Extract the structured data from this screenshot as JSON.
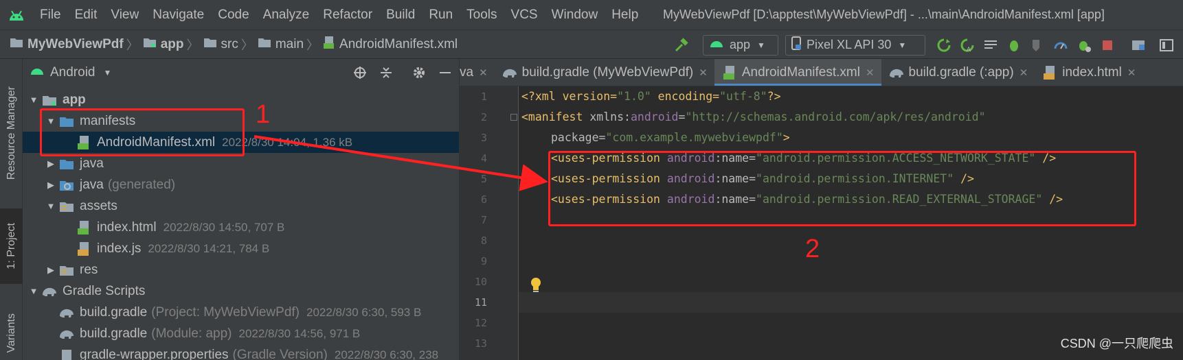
{
  "menu": [
    "File",
    "Edit",
    "View",
    "Navigate",
    "Code",
    "Analyze",
    "Refactor",
    "Build",
    "Run",
    "Tools",
    "VCS",
    "Window",
    "Help"
  ],
  "window_title": "MyWebViewPdf [D:\\apptest\\MyWebViewPdf] - ...\\main\\AndroidManifest.xml [app]",
  "breadcrumb": [
    "MyWebViewPdf",
    "app",
    "src",
    "main",
    "AndroidManifest.xml"
  ],
  "toolbar": {
    "run_config": "app",
    "device": "Pixel XL API 30"
  },
  "side_tabs": {
    "resource_manager": "Resource Manager",
    "project": "1: Project",
    "variants": "Variants"
  },
  "project_panel": {
    "view_mode": "Android",
    "tree": [
      {
        "name": "app",
        "meta": ""
      },
      {
        "name": "manifests",
        "meta": ""
      },
      {
        "name": "AndroidManifest.xml",
        "meta": "2022/8/30 14:04, 1.36 kB"
      },
      {
        "name": "java",
        "meta": ""
      },
      {
        "name": "java",
        "suffix": "(generated)",
        "meta": ""
      },
      {
        "name": "assets",
        "meta": ""
      },
      {
        "name": "index.html",
        "meta": "2022/8/30 14:50, 707 B"
      },
      {
        "name": "index.js",
        "meta": "2022/8/30 14:21, 784 B"
      },
      {
        "name": "res",
        "meta": ""
      },
      {
        "name": "Gradle Scripts",
        "meta": ""
      },
      {
        "name": "build.gradle",
        "suffix": "(Project: MyWebViewPdf)",
        "meta": "2022/8/30 6:30, 593 B"
      },
      {
        "name": "build.gradle",
        "suffix": "(Module: app)",
        "meta": "2022/8/30 14:56, 971 B"
      },
      {
        "name": "gradle-wrapper.properties",
        "suffix": "(Gradle Version)",
        "meta": "2022/8/30 6:30, 238"
      }
    ]
  },
  "editor_tabs": [
    {
      "label": "va"
    },
    {
      "label": "build.gradle (MyWebViewPdf)"
    },
    {
      "label": "AndroidManifest.xml",
      "active": true
    },
    {
      "label": "build.gradle (:app)"
    },
    {
      "label": "index.html"
    }
  ],
  "editor": {
    "line_numbers": [
      "1",
      "2",
      "3",
      "4",
      "5",
      "6",
      "7",
      "8",
      "9",
      "10",
      "11",
      "12",
      "13"
    ],
    "current_line": "11",
    "lines": {
      "l1": {
        "a": "<?xml version=",
        "b": "\"1.0\"",
        "c": " encoding=",
        "d": "\"utf-8\"",
        "e": "?>"
      },
      "l2": {
        "a": "<manifest ",
        "b": "xmlns:",
        "c": "android",
        "d": "=",
        "e": "\"http://schemas.android.com/apk/res/android\""
      },
      "l3": {
        "a": "package=",
        "b": "\"com.example.mywebviewpdf\"",
        "c": ">"
      },
      "l4": {
        "a": "<uses-permission ",
        "b": "android",
        "c": ":name=",
        "d": "\"android.permission.ACCESS_NETWORK_STATE\"",
        "e": " />"
      },
      "l5": {
        "a": "<uses-permission ",
        "b": "android",
        "c": ":name=",
        "d": "\"android.permission.INTERNET\"",
        "e": " />"
      },
      "l6": {
        "a": "<uses-permission ",
        "b": "android",
        "c": ":name=",
        "d": "\"android.permission.READ_EXTERNAL_STORAGE\"",
        "e": " />"
      }
    }
  },
  "annotations": {
    "label1": "1",
    "label2": "2"
  },
  "watermark": "CSDN @一只爬爬虫",
  "colors": {
    "annotation": "#ff2121",
    "selection": "#0d293e",
    "active_tab_underline": "#4a88c7"
  }
}
